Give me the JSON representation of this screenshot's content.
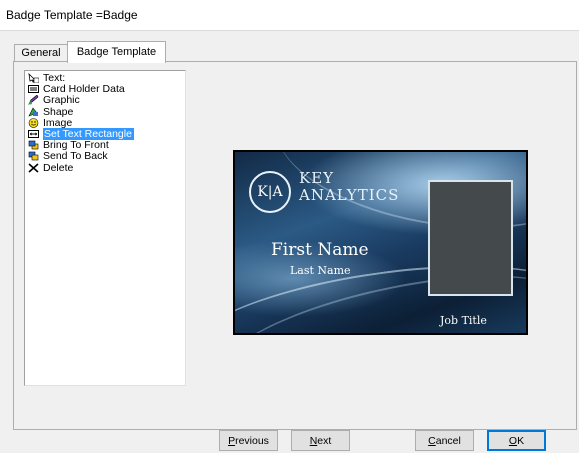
{
  "window": {
    "title": "Badge Template =Badge"
  },
  "tabs": [
    {
      "label": "General"
    },
    {
      "label": "Badge Template"
    }
  ],
  "toolbox": {
    "items": [
      {
        "label": "Text:",
        "icon": "text-tool-icon"
      },
      {
        "label": "Card Holder Data",
        "icon": "card-holder-data-icon"
      },
      {
        "label": "Graphic",
        "icon": "graphic-icon"
      },
      {
        "label": "Shape",
        "icon": "shape-icon"
      },
      {
        "label": "Image",
        "icon": "image-smiley-icon"
      },
      {
        "label": "Set Text Rectangle",
        "icon": "text-rectangle-icon",
        "selected": true
      },
      {
        "label": "Bring To Front",
        "icon": "bring-to-front-icon"
      },
      {
        "label": "Send To Back",
        "icon": "send-to-back-icon"
      },
      {
        "label": "Delete",
        "icon": "delete-x-icon"
      }
    ]
  },
  "badge": {
    "logo_mark": "K|A",
    "logo_line1": "KEY",
    "logo_line2": "ANALYTICS",
    "first_name": "First Name",
    "last_name": "Last Name",
    "job_title": "Job Title",
    "photo_color": "#44494c"
  },
  "buttons": {
    "previous": {
      "mnemonic": "P",
      "rest": "revious"
    },
    "next": {
      "mnemonic": "N",
      "rest": "ext"
    },
    "cancel": {
      "mnemonic": "C",
      "rest": "ancel"
    },
    "ok": {
      "mnemonic": "O",
      "rest": "K"
    }
  },
  "colors": {
    "selection": "#3399ff",
    "dialog_bg": "#f0f0f0",
    "default_button_border": "#0078d7"
  }
}
